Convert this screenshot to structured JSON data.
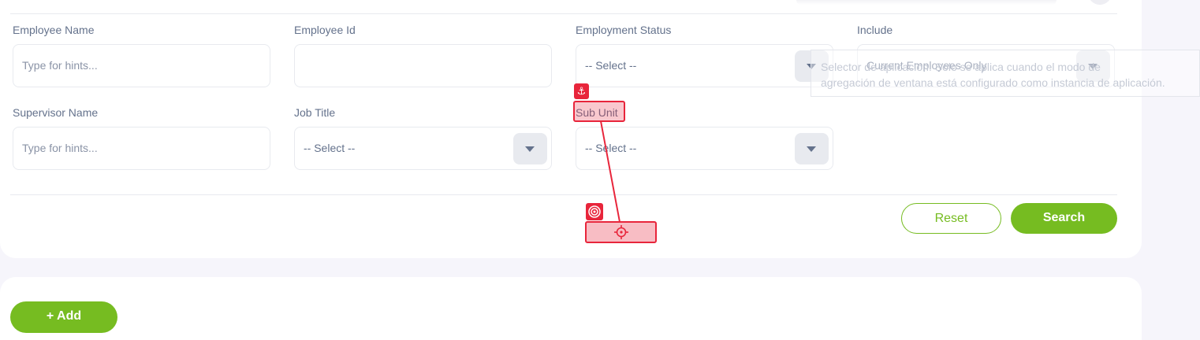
{
  "filters": {
    "employee_name": {
      "label": "Employee Name",
      "placeholder": "Type for hints..."
    },
    "employee_id": {
      "label": "Employee Id",
      "value": ""
    },
    "employment_status": {
      "label": "Employment Status",
      "value": "-- Select --"
    },
    "include": {
      "label": "Include",
      "value": "Current Employees Only"
    },
    "supervisor_name": {
      "label": "Supervisor Name",
      "placeholder": "Type for hints..."
    },
    "job_title": {
      "label": "Job Title",
      "value": "-- Select --"
    },
    "sub_unit": {
      "label": "Sub Unit",
      "value": "-- Select --"
    }
  },
  "actions": {
    "reset_label": "Reset",
    "search_label": "Search",
    "add_label": "+ Add"
  },
  "tooltip": {
    "line1": "Selector de aplicación. Solo se aplica cuando el modo de",
    "line2": "agregación de ventana está configurado como instancia de aplicación."
  },
  "colors": {
    "accent": "#76bc21",
    "annotation_red": "#e8253b",
    "label_text": "#64728c"
  },
  "icons": {
    "dropdown": "chevron-down-icon",
    "anchor": "anchor-icon",
    "target": "target-icon",
    "crosshair": "crosshair-icon"
  }
}
